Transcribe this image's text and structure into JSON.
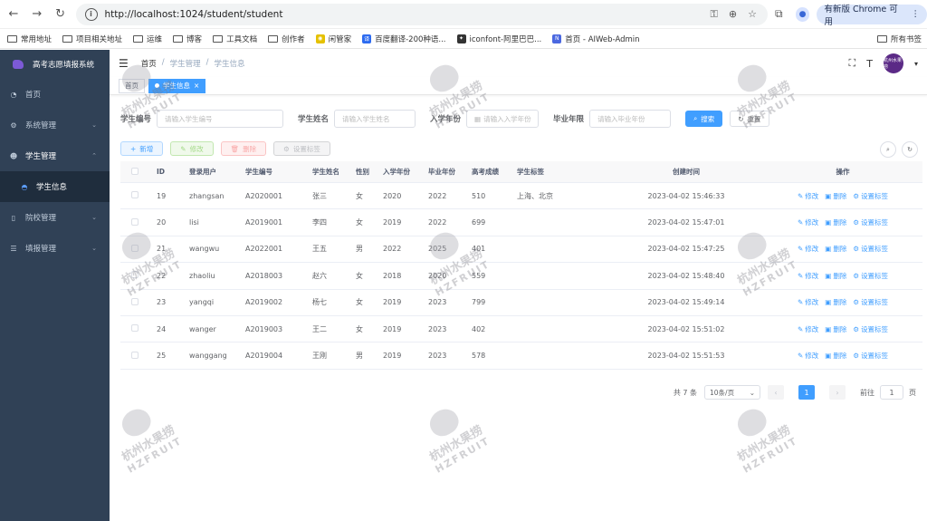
{
  "browser": {
    "url": "http://localhost:1024/student/student",
    "update_label": "有新版 Chrome 可用",
    "avatar_letter": "👤"
  },
  "bookmarks": {
    "items": [
      "常用地址",
      "项目相关地址",
      "运维",
      "博客",
      "工具文档",
      "创作者",
      "闲管家",
      "百度翻译-200种语...",
      "iconfont-阿里巴巴...",
      "首页 - AIWeb-Admin"
    ],
    "right": "所有书签"
  },
  "sidebar": {
    "title": "高考志愿填报系统",
    "items": [
      {
        "label": "首页"
      },
      {
        "label": "系统管理"
      },
      {
        "label": "学生管理"
      },
      {
        "label": "学生信息"
      },
      {
        "label": "院校管理"
      },
      {
        "label": "填报管理"
      }
    ]
  },
  "navbar": {
    "breadcrumb": [
      "首页",
      "/",
      "学生管理",
      "/",
      "学生信息"
    ],
    "avatar_text": "杭州水果捞"
  },
  "tags": {
    "home": "首页",
    "active": "学生信息"
  },
  "search": {
    "student_no_label": "学生编号",
    "student_no_ph": "请输入学生编号",
    "name_label": "学生姓名",
    "name_ph": "请输入学生姓名",
    "year_label": "入学年份",
    "year_ph": "请输入入学年份",
    "grad_label": "毕业年限",
    "grad_ph": "请输入毕业年份",
    "search_btn": "搜索",
    "reset_btn": "重置"
  },
  "toolbar": {
    "add": "新增",
    "edit": "修改",
    "delete": "删除",
    "set_tag": "设置标签"
  },
  "table": {
    "headers": [
      "ID",
      "登录用户",
      "学生编号",
      "学生姓名",
      "性别",
      "入学年份",
      "毕业年份",
      "高考成绩",
      "学生标签",
      "创建时间",
      "操作"
    ],
    "rows": [
      [
        "19",
        "zhangsan",
        "A2020001",
        "张三",
        "女",
        "2020",
        "2022",
        "510",
        "上海、北京",
        "2023-04-02 15:46:33"
      ],
      [
        "20",
        "lisi",
        "A2019001",
        "李四",
        "女",
        "2019",
        "2022",
        "699",
        "",
        "2023-04-02 15:47:01"
      ],
      [
        "21",
        "wangwu",
        "A2022001",
        "王五",
        "男",
        "2022",
        "2025",
        "401",
        "",
        "2023-04-02 15:47:25"
      ],
      [
        "22",
        "zhaoliu",
        "A2018003",
        "赵六",
        "女",
        "2018",
        "2020",
        "559",
        "",
        "2023-04-02 15:48:40"
      ],
      [
        "23",
        "yangqi",
        "A2019002",
        "杨七",
        "女",
        "2019",
        "2023",
        "799",
        "",
        "2023-04-02 15:49:14"
      ],
      [
        "24",
        "wanger",
        "A2019003",
        "王二",
        "女",
        "2019",
        "2023",
        "402",
        "",
        "2023-04-02 15:51:02"
      ],
      [
        "25",
        "wanggang",
        "A2019004",
        "王刚",
        "男",
        "2019",
        "2023",
        "578",
        "",
        "2023-04-02 15:51:53"
      ]
    ],
    "op_edit": "修改",
    "op_delete": "删除",
    "op_tag": "设置标签"
  },
  "pager": {
    "total": "共 7 条",
    "size": "10条/页",
    "page": "1",
    "goto": "前往",
    "goto_value": "1",
    "page_unit": "页"
  },
  "watermark": {
    "cn": "杭州水果捞",
    "en": "HZFRUIT"
  },
  "colors": {
    "primary": "#409eff",
    "sidebar_bg": "#304156"
  }
}
